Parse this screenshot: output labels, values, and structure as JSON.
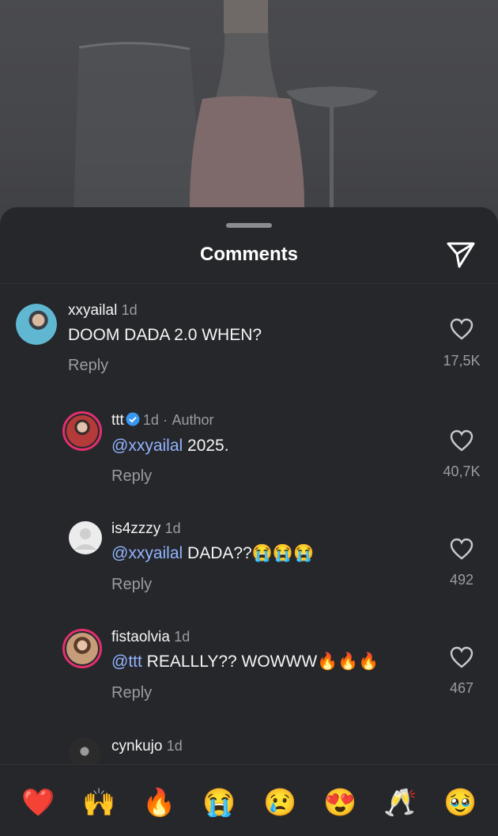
{
  "sheet": {
    "title": "Comments"
  },
  "comments": [
    {
      "username": "xxyailal",
      "time": "1d",
      "mention": "",
      "text": "DOOM DADA 2.0 WHEN?",
      "emojis": "",
      "reply_label": "Reply",
      "likes": "17,5K"
    },
    {
      "username": "ttt",
      "verified": true,
      "time": "1d",
      "separator": "·",
      "badge": "Author",
      "mention": "@xxyailal",
      "text": " 2025.",
      "emojis": "",
      "reply_label": "Reply",
      "likes": "40,7K"
    },
    {
      "username": "is4zzzy",
      "time": "1d",
      "mention": "@xxyailal",
      "text": " DADA??",
      "emojis": "😭😭😭",
      "reply_label": "Reply",
      "likes": "492"
    },
    {
      "username": "fistaolvia",
      "time": "1d",
      "mention": "@ttt",
      "text": " REALLLY?? WOWWW",
      "emojis": "🔥🔥🔥",
      "reply_label": "Reply",
      "likes": "467"
    },
    {
      "username": "cynkujo",
      "time": "1d"
    }
  ],
  "reactions": [
    "❤️",
    "🙌",
    "🔥",
    "😭",
    "😢",
    "😍",
    "🥂",
    "🥹"
  ],
  "colors": {
    "sheet_bg": "#25272b",
    "mention": "#93b4ff",
    "story_ring": "#e1306c",
    "verified": "#3897f0"
  },
  "icons": {
    "send": "paper-plane-icon",
    "like": "heart-outline-icon",
    "verified": "verified-badge-icon"
  }
}
